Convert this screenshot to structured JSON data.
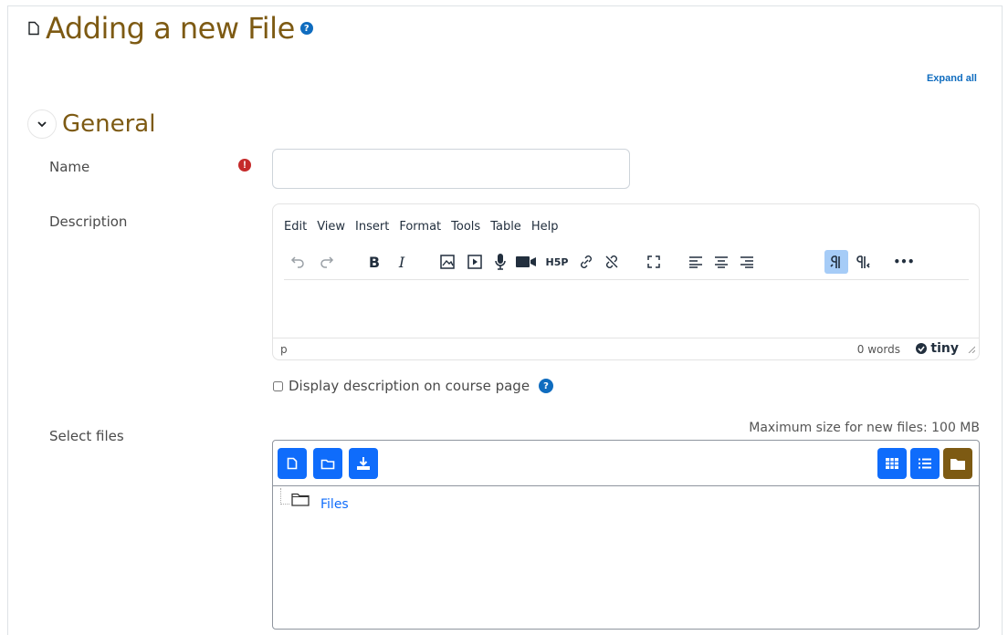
{
  "header": {
    "title": "Adding a new File",
    "help_glyph": "?",
    "title_icon": "file-icon"
  },
  "expand_all_label": "Expand all",
  "section": {
    "title": "General",
    "toggle_icon": "chevron-down-icon"
  },
  "form": {
    "name": {
      "label": "Name",
      "value": "",
      "required_glyph": "!"
    },
    "description": {
      "label": "Description",
      "menu": [
        "Edit",
        "View",
        "Insert",
        "Format",
        "Tools",
        "Table",
        "Help"
      ],
      "toolbar_icons": [
        "undo-icon",
        "redo-icon",
        "bold-icon",
        "italic-icon",
        "image-icon",
        "media-icon",
        "record-audio-icon",
        "record-video-icon",
        "h5p-icon",
        "link-icon",
        "unlink-icon",
        "fullscreen-icon",
        "align-left-icon",
        "align-center-icon",
        "align-right-icon",
        "ltr-icon",
        "rtl-icon",
        "more-icon"
      ],
      "bold_label": "B",
      "italic_label": "I",
      "h5p_label": "H5P",
      "more_label": "•••",
      "status_path": "p",
      "word_count": "0 words",
      "brand": "tiny"
    },
    "display_description": {
      "label": "Display description on course page",
      "checked": false,
      "help_glyph": "?"
    },
    "select_files": {
      "label": "Select files",
      "max_size": "Maximum size for new files: 100 MB",
      "buttons": [
        "add-file-icon",
        "create-folder-icon",
        "download-icon"
      ],
      "view_buttons": [
        "grid-view-icon",
        "list-view-icon",
        "tree-view-icon"
      ],
      "tree_root": "Files"
    }
  },
  "colors": {
    "title": "#7d5a13",
    "primary": "#0f6cfb",
    "link": "#0f6cbf",
    "required": "#c52a2a",
    "active_view": "#7d5a13"
  }
}
